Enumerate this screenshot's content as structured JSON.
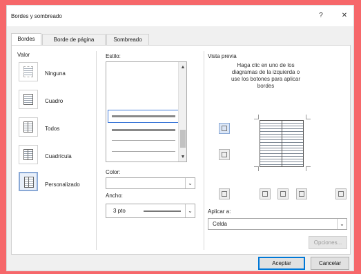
{
  "dialog": {
    "title": "Bordes y sombreado",
    "help_glyph": "?",
    "close_glyph": "✕"
  },
  "tabs": [
    {
      "label": "Bordes",
      "active": true
    },
    {
      "label": "Borde de página",
      "active": false
    },
    {
      "label": "Sombreado",
      "active": false
    }
  ],
  "setting": {
    "label": "Valor",
    "options": [
      {
        "label": "Ninguna",
        "selected": false
      },
      {
        "label": "Cuadro",
        "selected": false
      },
      {
        "label": "Todos",
        "selected": false
      },
      {
        "label": "Cuadrícula",
        "selected": false
      },
      {
        "label": "Personalizado",
        "selected": true
      }
    ]
  },
  "style": {
    "label": "Estilo:",
    "scroll_up": "▲",
    "scroll_down": "▼"
  },
  "color": {
    "label": "Color:",
    "value": ""
  },
  "width": {
    "label": "Ancho:",
    "value": "3 pto"
  },
  "preview": {
    "label": "Vista previa",
    "instructions": "Haga clic en uno de los diagramas de la izquierda o use los botones para aplicar bordes"
  },
  "apply_to": {
    "label": "Aplicar a:",
    "value": "Celda"
  },
  "buttons": {
    "options": "Opciones...",
    "accept": "Aceptar",
    "cancel": "Cancelar"
  },
  "colors": {
    "background": "#f6676a",
    "dialog": "#f0f0f0",
    "accent": "#0078d7"
  }
}
